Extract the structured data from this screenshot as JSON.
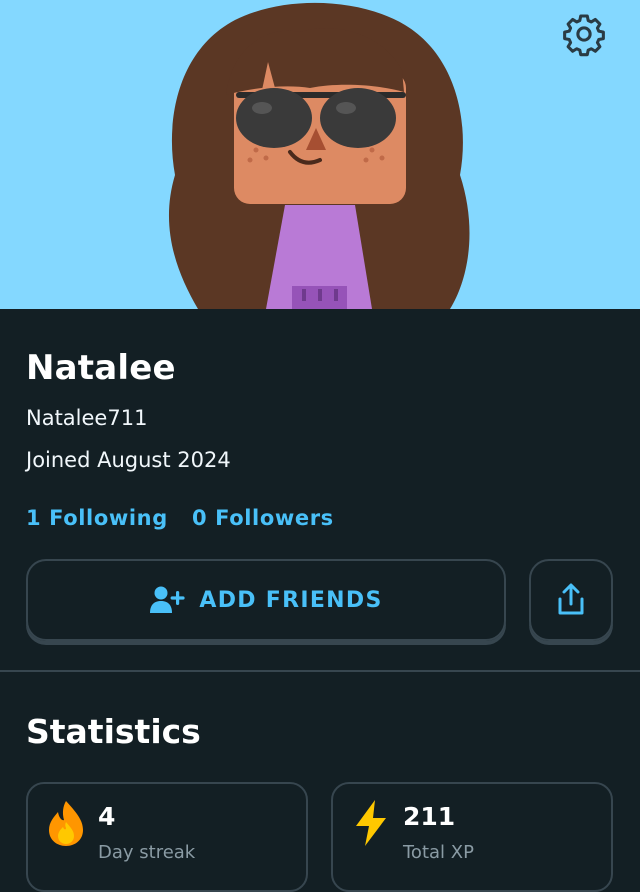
{
  "header": {
    "settings_icon": "gear-icon",
    "avatar": "avatar-illustration"
  },
  "profile": {
    "name": "Natalee",
    "username": "Natalee711",
    "joined": "Joined August 2024",
    "following": "1 Following",
    "followers": "0 Followers"
  },
  "actions": {
    "add_friends_label": "ADD FRIENDS",
    "add_friends_icon": "add-user-icon",
    "share_icon": "share-icon"
  },
  "statistics": {
    "title": "Statistics",
    "cards": [
      {
        "icon": "flame-icon",
        "value": "4",
        "label": "Day streak"
      },
      {
        "icon": "lightning-icon",
        "value": "211",
        "label": "Total XP"
      }
    ]
  },
  "colors": {
    "background": "#131f24",
    "hero_background": "#84d8ff",
    "accent": "#49c0f8",
    "border": "#37464f"
  }
}
